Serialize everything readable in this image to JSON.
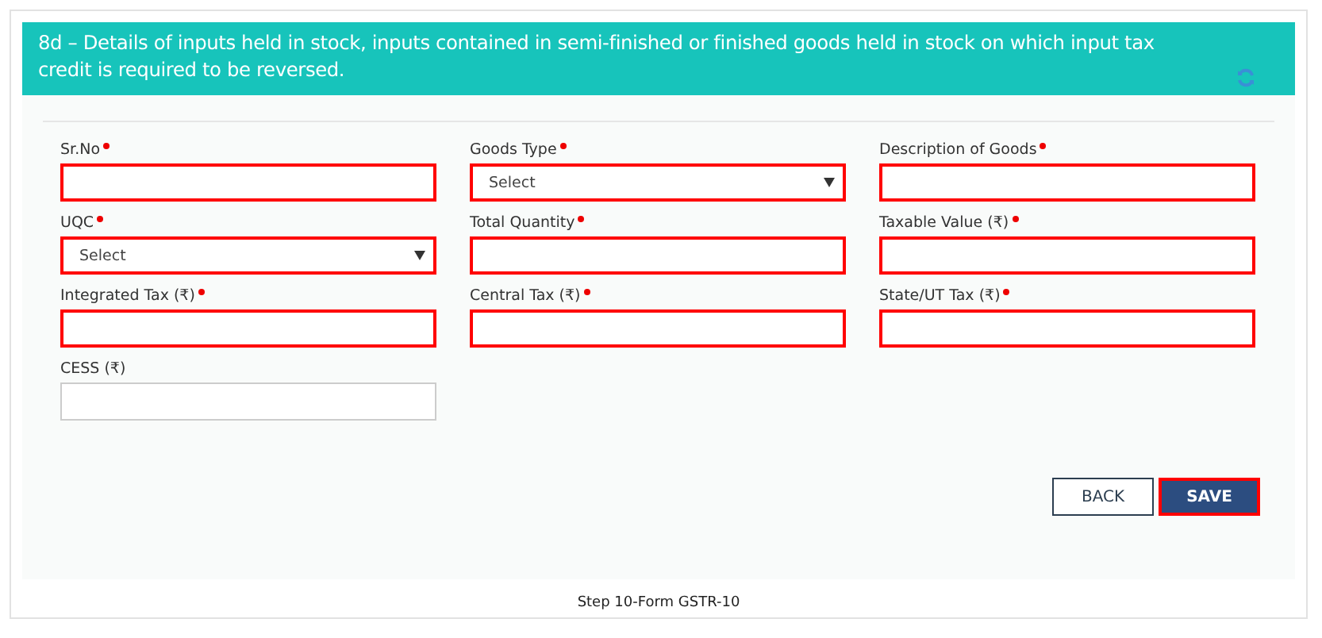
{
  "header": {
    "title": "8d – Details of inputs held in stock, inputs contained in semi-finished or finished goods held in stock on which input tax credit is required to be reversed."
  },
  "fields": [
    {
      "label": "Sr.No",
      "required": true,
      "kind": "text",
      "highlighted": true
    },
    {
      "label": "Goods Type",
      "required": true,
      "kind": "select",
      "value": "Select",
      "highlighted": true
    },
    {
      "label": "Description of Goods",
      "required": true,
      "kind": "text",
      "highlighted": true
    },
    {
      "label": "UQC",
      "required": true,
      "kind": "select",
      "value": "Select",
      "highlighted": true
    },
    {
      "label": "Total Quantity",
      "required": true,
      "kind": "text",
      "highlighted": true
    },
    {
      "label": "Taxable Value (₹)",
      "required": true,
      "kind": "text",
      "highlighted": true
    },
    {
      "label": "Integrated Tax (₹)",
      "required": true,
      "kind": "text",
      "highlighted": true
    },
    {
      "label": "Central Tax (₹)",
      "required": true,
      "kind": "text",
      "highlighted": true
    },
    {
      "label": "State/UT Tax (₹)",
      "required": true,
      "kind": "text",
      "highlighted": true
    },
    {
      "label": "CESS (₹)",
      "required": false,
      "kind": "text",
      "highlighted": false
    }
  ],
  "buttons": [
    {
      "label": "BACK",
      "kind": "secondary",
      "highlighted": false
    },
    {
      "label": "SAVE",
      "kind": "primary",
      "highlighted": true
    }
  ],
  "caption": "Step 10-Form GSTR-10"
}
